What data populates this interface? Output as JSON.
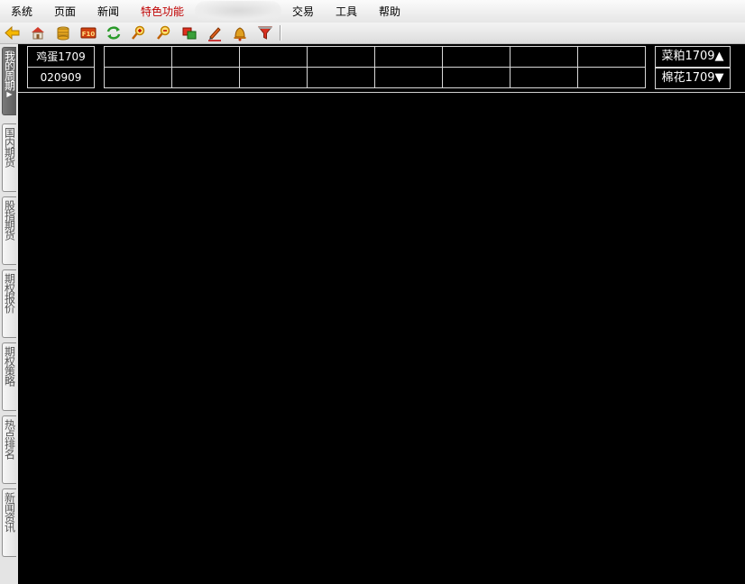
{
  "menu": {
    "items": [
      "系统",
      "页面",
      "新闻",
      "特色功能",
      "交易",
      "工具",
      "帮助"
    ],
    "accent_item": "特色功能",
    "accent_color": "#c00000"
  },
  "toolbar": {
    "icons": [
      "back-arrow-icon",
      "home-icon",
      "database-icon",
      "f10-icon",
      "refresh-icon",
      "zoom-in-icon",
      "zoom-out-icon",
      "window-icon",
      "pencil-icon",
      "bell-icon",
      "filter-icon"
    ],
    "f10_label": "F10"
  },
  "sidebar": {
    "tabs": [
      {
        "label": "我的周期",
        "active": true
      },
      {
        "label": "国内期货",
        "active": false
      },
      {
        "label": "股指期货",
        "active": false
      },
      {
        "label": "期权报价",
        "active": false
      },
      {
        "label": "期权策略",
        "active": false
      },
      {
        "label": "热点排名",
        "active": false
      },
      {
        "label": "新闻资讯",
        "active": false
      }
    ]
  },
  "quote_panel": {
    "left": {
      "name": "鸡蛋1709",
      "code": "020909"
    },
    "right": {
      "up": "菜粕1709▲",
      "down": "棉花1709▼"
    }
  },
  "colors": {
    "background": "#000000",
    "text": "#ffffff",
    "grid": "#d8d8d8"
  }
}
